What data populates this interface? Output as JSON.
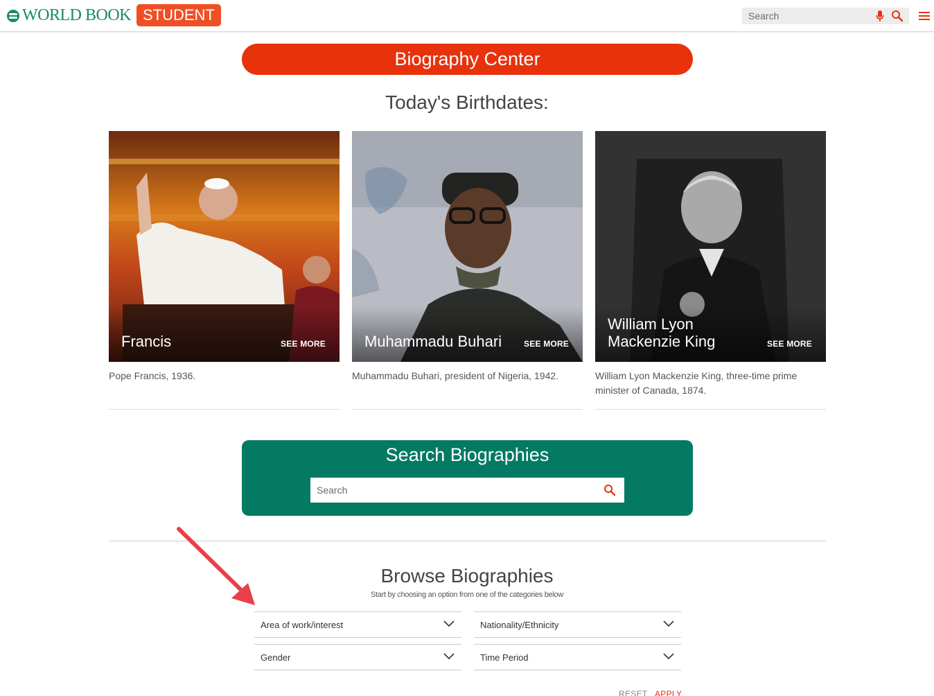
{
  "header": {
    "logo_text": "WORLD BOOK",
    "logo_badge": "STUDENT",
    "search_placeholder": "Search"
  },
  "banner": {
    "title": "Biography Center"
  },
  "birthdates": {
    "heading": "Today's Birthdates:",
    "cards": [
      {
        "name": "Francis",
        "see_more": "SEE MORE",
        "caption": "Pope Francis, 1936."
      },
      {
        "name": "Muhammadu Buhari",
        "see_more": "SEE MORE",
        "caption": "Muhammadu Buhari, president of Nigeria, 1942."
      },
      {
        "name": "William Lyon Mackenzie King",
        "see_more": "SEE MORE",
        "caption": "William Lyon Mackenzie King, three-time prime minister of Canada, 1874."
      }
    ]
  },
  "search_biographies": {
    "title": "Search Biographies",
    "placeholder": "Search"
  },
  "browse": {
    "heading": "Browse Biographies",
    "subtitle": "Start by choosing an option from one of the categories below",
    "filters": [
      {
        "label": "Area of work/interest"
      },
      {
        "label": "Nationality/Ethnicity"
      },
      {
        "label": "Gender"
      },
      {
        "label": "Time Period"
      }
    ],
    "reset_label": "RESET",
    "apply_label": "APPLY"
  },
  "colors": {
    "brand_green": "#047a62",
    "brand_red": "#e8320c",
    "logo_orange": "#f04e23",
    "annotation_arrow": "#e8404a"
  }
}
